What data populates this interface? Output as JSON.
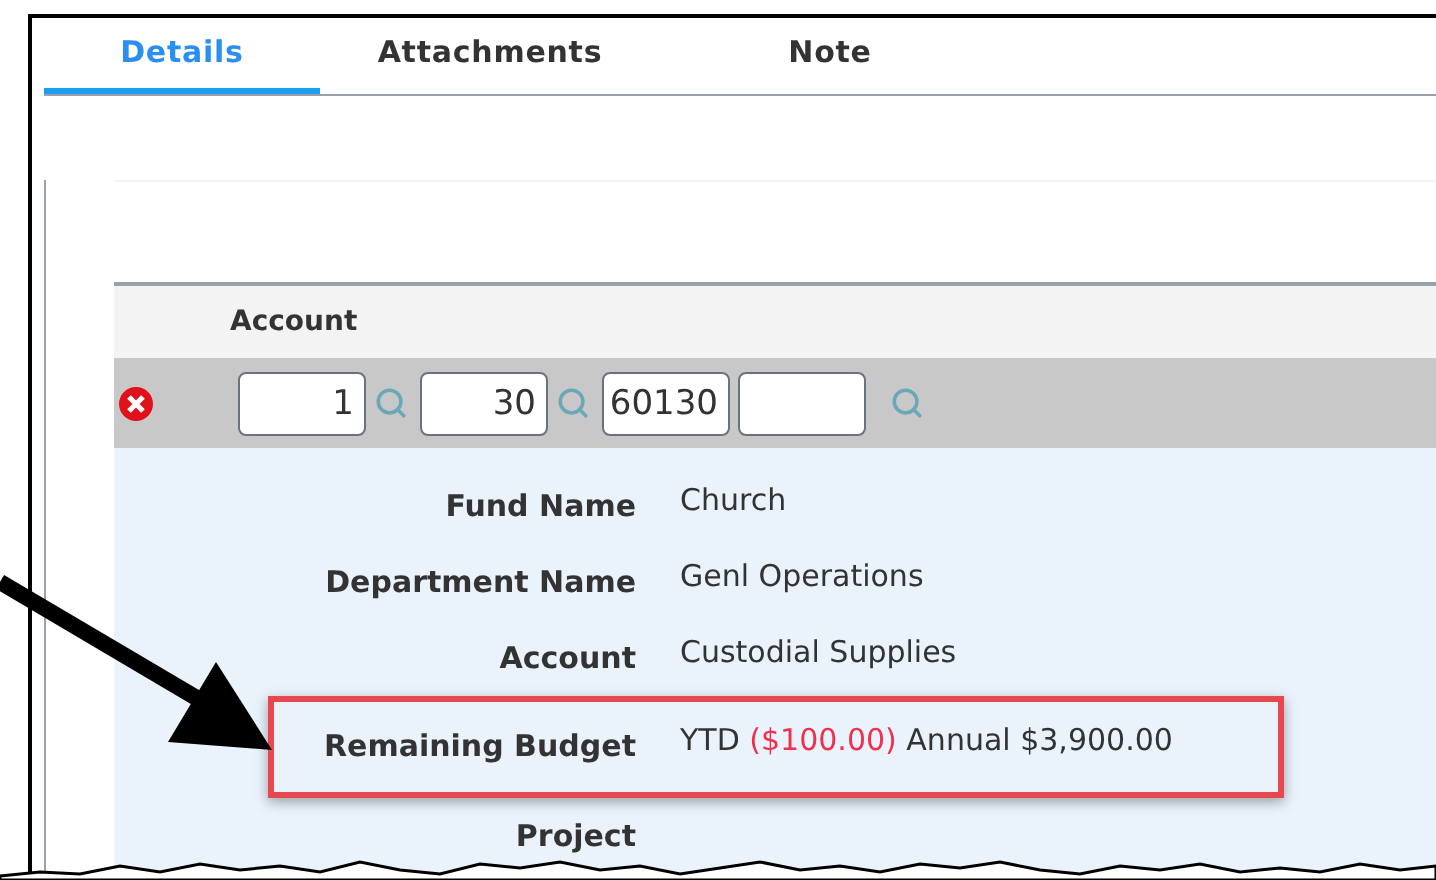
{
  "tabs": [
    {
      "label": "Details",
      "selected": true
    },
    {
      "label": "Attachments",
      "selected": false
    },
    {
      "label": "Note",
      "selected": false
    }
  ],
  "grid": {
    "header": "Account",
    "fields": [
      {
        "value": "1",
        "kind": "lookup"
      },
      {
        "value": "30",
        "kind": "lookup"
      },
      {
        "value": "60130",
        "kind": "plain"
      },
      {
        "kind": "lookup"
      }
    ]
  },
  "details": [
    {
      "label": "Fund Name",
      "value": [
        {
          "text": "Church",
          "kind": "normal"
        }
      ],
      "highlighted": false
    },
    {
      "label": "Department Name",
      "value": [
        {
          "text": "Genl Operations",
          "kind": "normal"
        }
      ],
      "highlighted": false
    },
    {
      "label": "Account",
      "value": [
        {
          "text": "Custodial Supplies",
          "kind": "normal"
        }
      ],
      "highlighted": false
    },
    {
      "label": "Remaining Budget",
      "value": [
        {
          "text": "YTD",
          "kind": "normal"
        },
        {
          "text": "($100.00)",
          "kind": "negative"
        },
        {
          "text": "Annual $3,900.00",
          "kind": "normal"
        }
      ],
      "highlighted": true
    },
    {
      "label": "Project",
      "highlighted": false
    }
  ]
}
